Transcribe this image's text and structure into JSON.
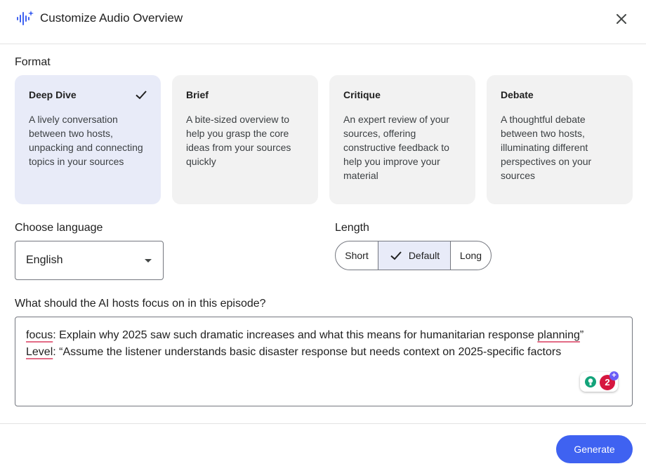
{
  "header": {
    "title": "Customize Audio Overview",
    "logo_icon": "audio-sparkle-icon",
    "close_icon": "close-icon"
  },
  "format": {
    "label": "Format",
    "options": [
      {
        "title": "Deep Dive",
        "description": "A lively conversation between two hosts, unpacking and connecting topics in your sources",
        "selected": true
      },
      {
        "title": "Brief",
        "description": "A bite-sized overview to help you grasp the core ideas from your sources quickly",
        "selected": false
      },
      {
        "title": "Critique",
        "description": "An expert review of your sources, offering constructive feedback to help you improve your material",
        "selected": false
      },
      {
        "title": "Debate",
        "description": "A thoughtful debate between two hosts, illuminating different perspectives on your sources",
        "selected": false
      }
    ]
  },
  "language": {
    "label": "Choose language",
    "selected": "English"
  },
  "length": {
    "label": "Length",
    "options": [
      "Short",
      "Default",
      "Long"
    ],
    "selected": "Default"
  },
  "focus": {
    "label": "What should the AI hosts focus on in this episode?",
    "line1": {
      "word1": "focus",
      "mid": ": Explain why 2025 saw such dramatic increases and what this means for humanitarian response ",
      "word2": "planning",
      "end": "”"
    },
    "line2": {
      "word1": "Level",
      "rest": ": “Assume the listener understands basic disaster response but needs context on 2025-specific factors"
    }
  },
  "grammarly": {
    "count": "2",
    "plus": "+"
  },
  "footer": {
    "generate_label": "Generate"
  },
  "colors": {
    "accent": "#3f62f1",
    "selected_bg": "#e8ebf8",
    "card_bg": "#f2f2f2",
    "spell_underline": "#e26b86"
  }
}
